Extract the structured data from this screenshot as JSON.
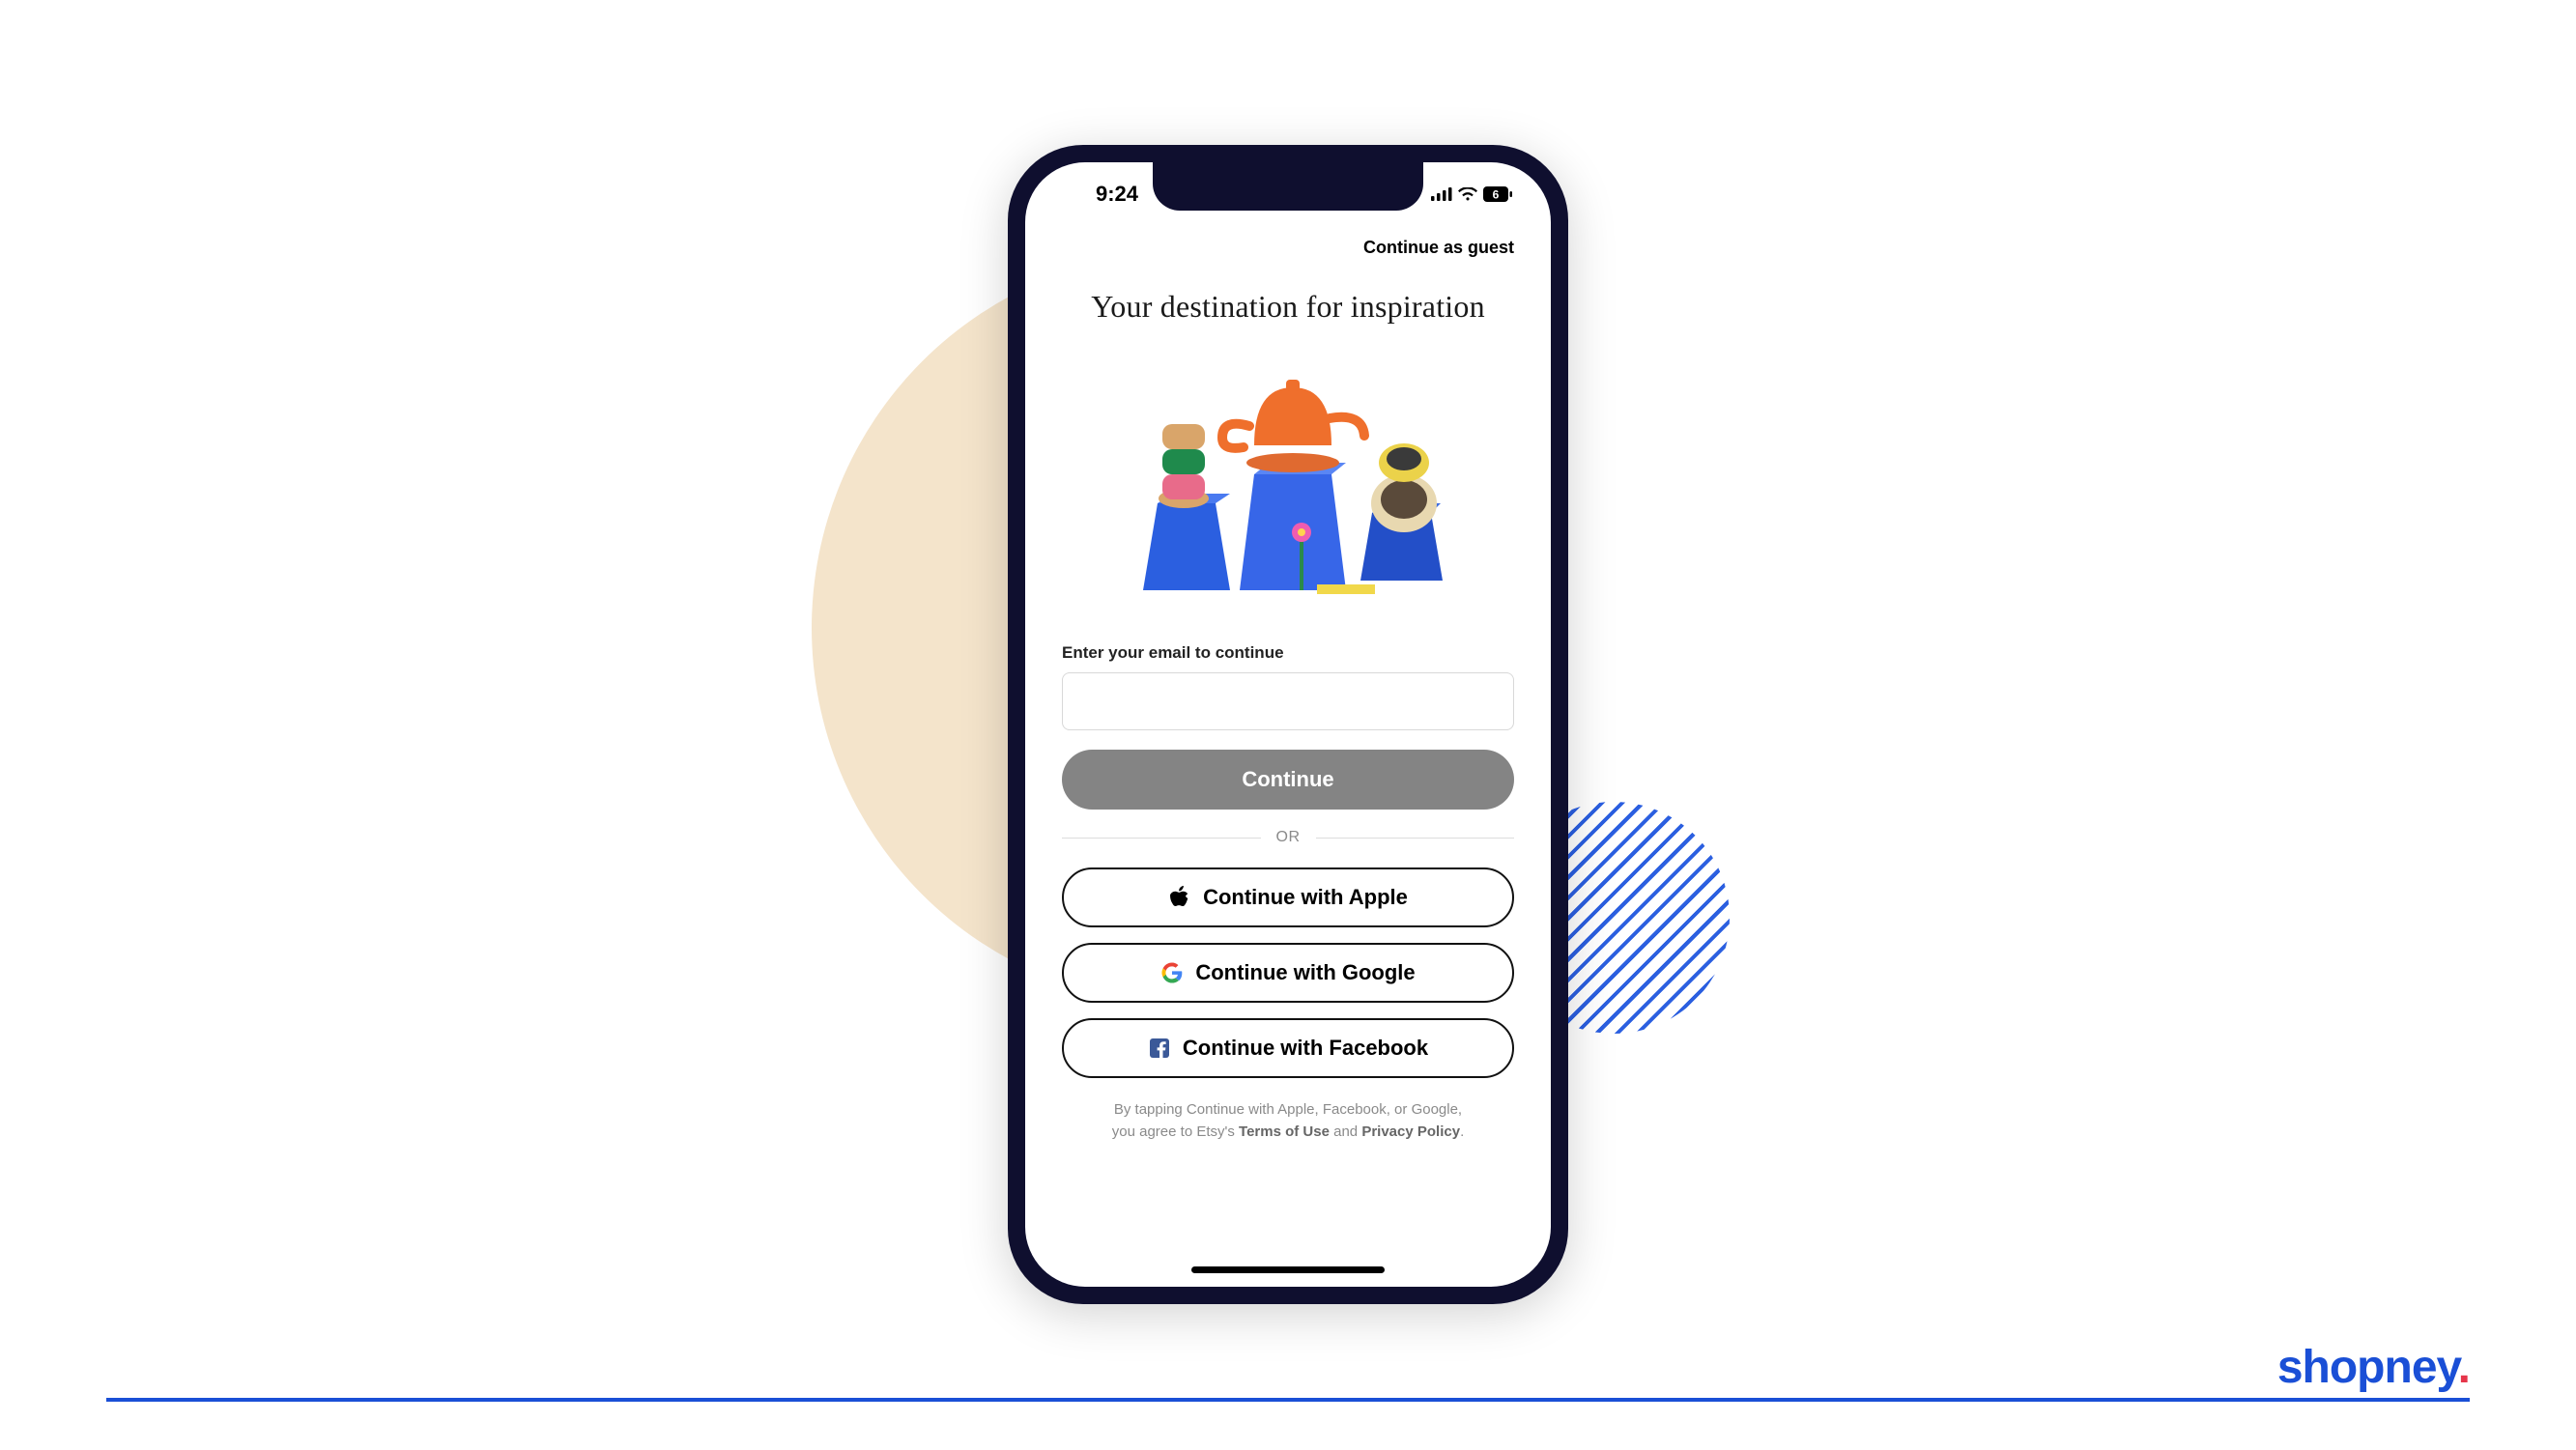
{
  "brand": {
    "name": "shopney",
    "dot": "."
  },
  "statusbar": {
    "time": "9:24",
    "battery_label": "6"
  },
  "header": {
    "guest_link": "Continue as guest"
  },
  "hero": {
    "headline": "Your destination for inspiration"
  },
  "form": {
    "email_label": "Enter your email to continue",
    "email_value": "",
    "email_placeholder": "",
    "continue_label": "Continue"
  },
  "divider": {
    "text": "OR"
  },
  "social": {
    "apple_label": "Continue with Apple",
    "google_label": "Continue with Google",
    "facebook_label": "Continue with Facebook"
  },
  "legal": {
    "line": "By tapping Continue with Apple, Facebook, or Google,",
    "prefix2": "you agree to Etsy's ",
    "terms": "Terms of Use",
    "joiner": " and ",
    "privacy": "Privacy Policy",
    "suffix": "."
  },
  "icons": {
    "apple": "apple-icon",
    "google": "google-icon",
    "facebook": "facebook-icon",
    "signal": "signal-icon",
    "wifi": "wifi-icon",
    "battery": "battery-icon"
  },
  "colors": {
    "accent_blue": "#1a4fd6",
    "accent_pink": "#e6354a",
    "bg_beige": "#f4e4cb",
    "btn_grey": "#848484"
  }
}
